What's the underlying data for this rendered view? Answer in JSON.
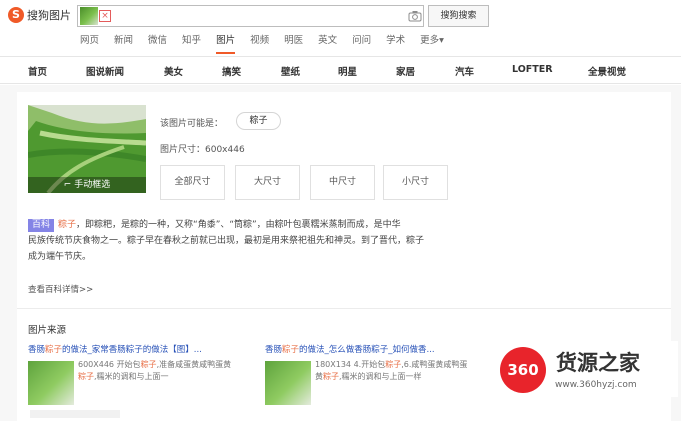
{
  "brand": {
    "logo_letter": "S",
    "name": "搜狗图片",
    "accent": "#f05a28"
  },
  "search": {
    "button_label": "搜狗搜索",
    "clear_label": "×"
  },
  "tabs": [
    "网页",
    "新闻",
    "微信",
    "知乎",
    "图片",
    "视频",
    "明医",
    "英文",
    "问问",
    "学术",
    "更多▾"
  ],
  "nav": [
    "首页",
    "图说新闻",
    "美女",
    "搞笑",
    "壁纸",
    "明星",
    "家居",
    "汽车",
    "LOFTER",
    "全景视觉"
  ],
  "result": {
    "guess_label": "该图片可能是：",
    "guess_chip": "粽子",
    "size_label": "图片尺寸：600x446",
    "crop_label": "手动框选",
    "size_buttons": [
      "全部尺寸",
      "大尺寸",
      "中尺寸",
      "小尺寸"
    ]
  },
  "baike": {
    "tag": "百科",
    "keyword": "粽子",
    "text_1": "，即粽粑，是粽的一种，又称“角黍”、“筒粽”，由粽叶包裹糯米蒸制而成，是中华",
    "text_2": "民族传统节庆食物之一。粽子早在春秋之前就已出现，最初是用来祭祀祖先和神灵。到了晋代，粽子",
    "text_3": "成为端午节庆。",
    "more": "查看百科详情>>"
  },
  "sources": {
    "title": "图片来源",
    "items": [
      {
        "title_a": "香肠",
        "title_kw": "粽子",
        "title_b": "的做法_家常香肠粽子的做法【图】...",
        "text_a": "600X446 开始包",
        "text_kw1": "粽子",
        "text_b": ",准备咸蛋黄咸鸭蛋黄",
        "text_kw2": "粽子",
        "text_c": ",糯米的调和与上面一"
      },
      {
        "title_a": "香肠",
        "title_kw": "粽子",
        "title_b": "的做法_怎么做香肠粽子_如何做香...",
        "text_a": "180X134 4.开始包",
        "text_kw1": "粽子",
        "text_b": ",6.咸鸭蛋黄咸鸭蛋黄",
        "text_kw2": "粽子",
        "text_c": ",糯米的调和与上面一样"
      }
    ]
  },
  "watermark": {
    "logo": "360",
    "name": "货源之家",
    "url": "www.360hyzj.com"
  }
}
